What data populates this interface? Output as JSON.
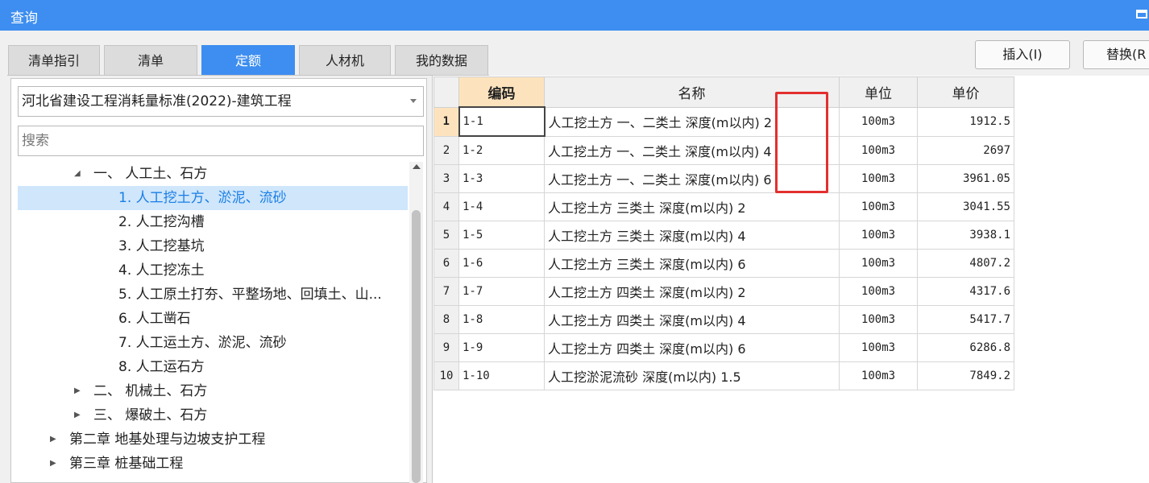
{
  "window": {
    "title": "查询"
  },
  "tabs": [
    {
      "label": "清单指引",
      "active": false
    },
    {
      "label": "清单",
      "active": false
    },
    {
      "label": "定额",
      "active": true
    },
    {
      "label": "人材机",
      "active": false
    },
    {
      "label": "我的数据",
      "active": false
    }
  ],
  "actions": {
    "insert_label": "插入(I)",
    "replace_label": "替换(R"
  },
  "library": {
    "selected": "河北省建设工程消耗量标准(2022)-建筑工程"
  },
  "search": {
    "placeholder": "搜索",
    "value": ""
  },
  "tree": [
    {
      "label": "一、 人工土、石方",
      "expanded": true,
      "level": 2,
      "selected": false
    },
    {
      "label": "1. 人工挖土方、淤泥、流砂",
      "level": 3,
      "selected": true
    },
    {
      "label": "2. 人工挖沟槽",
      "level": 3,
      "selected": false
    },
    {
      "label": "3. 人工挖基坑",
      "level": 3,
      "selected": false
    },
    {
      "label": "4. 人工挖冻土",
      "level": 3,
      "selected": false
    },
    {
      "label": "5. 人工原土打夯、平整场地、回填土、山...",
      "level": 3,
      "selected": false
    },
    {
      "label": "6. 人工凿石",
      "level": 3,
      "selected": false
    },
    {
      "label": "7. 人工运土方、淤泥、流砂",
      "level": 3,
      "selected": false
    },
    {
      "label": "8. 人工运石方",
      "level": 3,
      "selected": false
    },
    {
      "label": "二、 机械土、石方",
      "expanded": false,
      "level": 2,
      "selected": false
    },
    {
      "label": "三、 爆破土、石方",
      "expanded": false,
      "level": 2,
      "selected": false
    },
    {
      "label": "第二章 地基处理与边坡支护工程",
      "expanded": false,
      "level": 1,
      "selected": false
    },
    {
      "label": "第三章 桩基础工程",
      "expanded": false,
      "level": 1,
      "selected": false
    }
  ],
  "table": {
    "columns": [
      "编码",
      "名称",
      "单位",
      "单价"
    ],
    "rows": [
      {
        "num": "1",
        "code": "1-1",
        "name": "人工挖土方 一、二类土 深度(m以内) 2",
        "unit": "100m3",
        "price": "1912.5"
      },
      {
        "num": "2",
        "code": "1-2",
        "name": "人工挖土方 一、二类土 深度(m以内) 4",
        "unit": "100m3",
        "price": "2697"
      },
      {
        "num": "3",
        "code": "1-3",
        "name": "人工挖土方 一、二类土 深度(m以内) 6",
        "unit": "100m3",
        "price": "3961.05"
      },
      {
        "num": "4",
        "code": "1-4",
        "name": "人工挖土方 三类土 深度(m以内) 2",
        "unit": "100m3",
        "price": "3041.55"
      },
      {
        "num": "5",
        "code": "1-5",
        "name": "人工挖土方 三类土 深度(m以内) 4",
        "unit": "100m3",
        "price": "3938.1"
      },
      {
        "num": "6",
        "code": "1-6",
        "name": "人工挖土方 三类土 深度(m以内) 6",
        "unit": "100m3",
        "price": "4807.2"
      },
      {
        "num": "7",
        "code": "1-7",
        "name": "人工挖土方 四类土 深度(m以内) 2",
        "unit": "100m3",
        "price": "4317.6"
      },
      {
        "num": "8",
        "code": "1-8",
        "name": "人工挖土方 四类土 深度(m以内) 4",
        "unit": "100m3",
        "price": "5417.7"
      },
      {
        "num": "9",
        "code": "1-9",
        "name": "人工挖土方 四类土 深度(m以内) 6",
        "unit": "100m3",
        "price": "6286.8"
      },
      {
        "num": "10",
        "code": "1-10",
        "name": "人工挖淤泥流砂 深度(m以内) 1.5",
        "unit": "100m3",
        "price": "7849.2"
      }
    ]
  },
  "colors": {
    "accent": "#3d8ef0",
    "selection": "#cfe6fb",
    "header_highlight": "#fde3bd",
    "annotation": "#e32f2f"
  }
}
